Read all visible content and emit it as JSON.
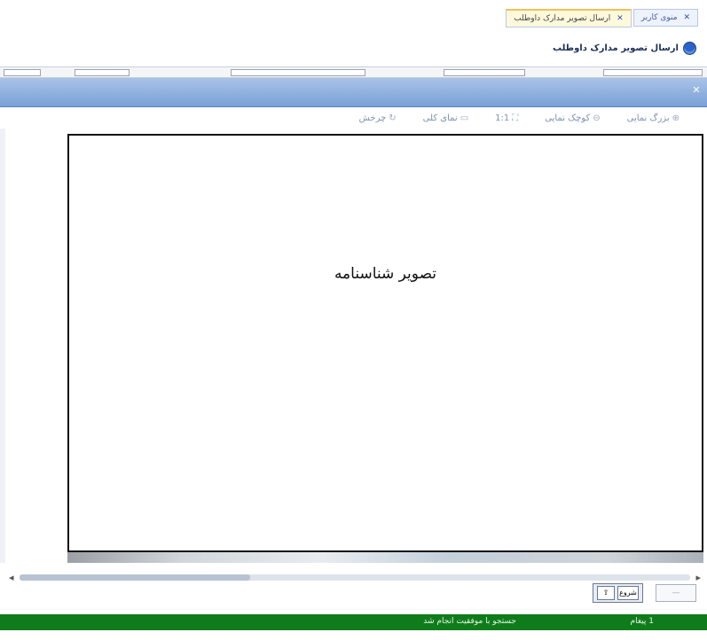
{
  "tabs": [
    {
      "label": "منوی کاربر",
      "active": false
    },
    {
      "label": "ارسال تصویر مدارک داوطلب",
      "active": true
    }
  ],
  "page_title": "ارسال تصویر مدارک داوطلب",
  "toolbar": {
    "zoom_in": "بزرگ نمایی",
    "zoom_out": "کوچک نمایی",
    "actual_size": "1:1",
    "fit": "نمای کلی",
    "rotate": "چرخش"
  },
  "viewer": {
    "image_label": "تصویر شناسنامه"
  },
  "pager": {
    "button_label": "شروع"
  },
  "status": {
    "message_count": "1 پیغام",
    "message": "جستجو با موفقیت انجام شد"
  },
  "colors": {
    "dialog_header": "#7aa1d6",
    "status_bar": "#0f7c1c"
  }
}
